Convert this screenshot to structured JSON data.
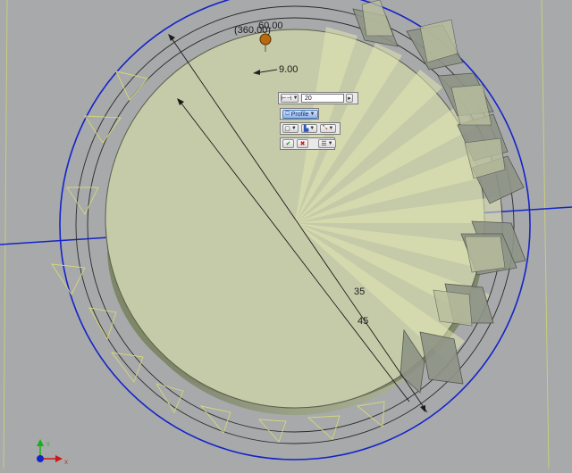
{
  "dimensions": {
    "angle_total": "(360.00)",
    "angle_step": "60.00",
    "offset": "9.00",
    "diameter_inner": "35",
    "diameter_outer": "45"
  },
  "mini_toolbar": {
    "count_value": "20",
    "profile_label": "Profile",
    "ok_symbol": "✔",
    "cancel_symbol": "✖"
  },
  "colors": {
    "background": "#a7a9ab",
    "body": "#c5cba8",
    "axis_blue": "#1424c8",
    "axis_red": "#d01818",
    "axis_green": "#18b018"
  }
}
